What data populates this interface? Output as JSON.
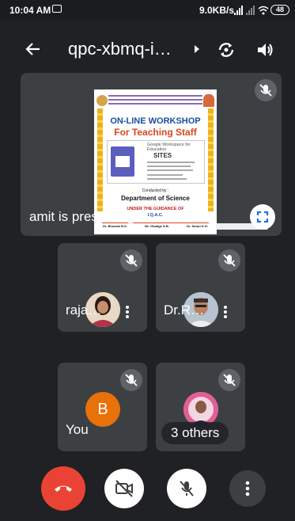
{
  "status_bar": {
    "time": "10:04 AM",
    "speed": "9.0KB/s",
    "battery": "48"
  },
  "header": {
    "meeting_code": "qpc-xbmq-i…",
    "back_icon": "arrow-left-icon",
    "switch_camera_icon": "camera-flip-icon",
    "audio_icon": "speaker-icon"
  },
  "presentation": {
    "label": "amit is presenting",
    "poster": {
      "title_line1": "ON-LINE WORKSHOP",
      "title_line2": "For Teaching Staff",
      "product_line": "Google Workspace for Education",
      "product_name": "SITES",
      "conducted_by": "Conducted by :",
      "department": "Department of Science",
      "guidance": "UNDER THE GUIDANCE OF",
      "iqac": "I.Q.A.C.",
      "footer_names": [
        "Dr. Bhosale B.S.",
        "Mr. Ghadge A.B.",
        "Dr. Suran K.N."
      ]
    }
  },
  "participants": [
    {
      "name": "raja…",
      "avatar": "photo"
    },
    {
      "name": "Dr.R…",
      "avatar": "photo"
    },
    {
      "name": "You",
      "avatar_letter": "B",
      "avatar_color": "#e8710a"
    },
    {
      "name": "3 others",
      "avatar": "photo"
    }
  ],
  "controls": {
    "hangup_color": "#ea4335",
    "items": [
      "end-call",
      "camera-off",
      "mic-off",
      "more-options"
    ]
  }
}
